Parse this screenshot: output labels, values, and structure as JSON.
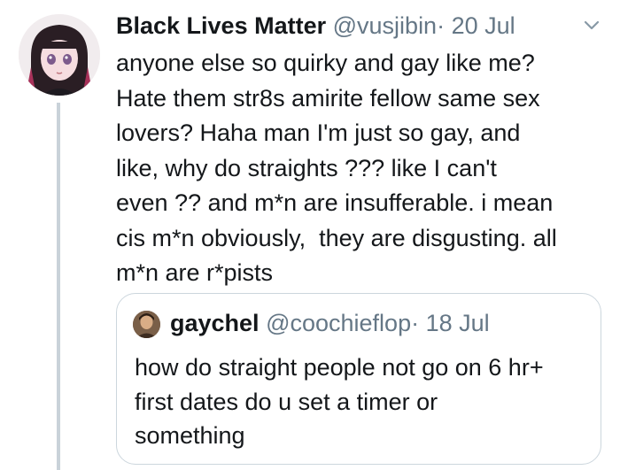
{
  "tweet": {
    "author_name": "Black Lives Matter",
    "handle": "@vusjibin",
    "separator": "·",
    "time": "20 Jul",
    "more_icon": "chevron-down-icon",
    "lines": [
      "anyone else so quirky and gay like me?",
      "Hate them str8s amirite fellow same sex",
      "lovers? Haha man I'm just so gay, and",
      "like, why do straights ??? like I can't",
      "even ?? and m*n are insufferable. i mean",
      "cis m*n obviously,  they are disgusting. all",
      "m*n are r*pists"
    ]
  },
  "quoted_tweet": {
    "author_name": "gaychel",
    "handle": "@coochieflop",
    "separator": "·",
    "time": "18 Jul",
    "lines": [
      "how do straight people not go on 6 hr+",
      "first dates do u set a timer or",
      "something"
    ]
  },
  "colors": {
    "text": "#14171a",
    "secondary_text": "#657786",
    "quote_border": "#ccd6dd",
    "thread_line": "#c9d2d9"
  }
}
